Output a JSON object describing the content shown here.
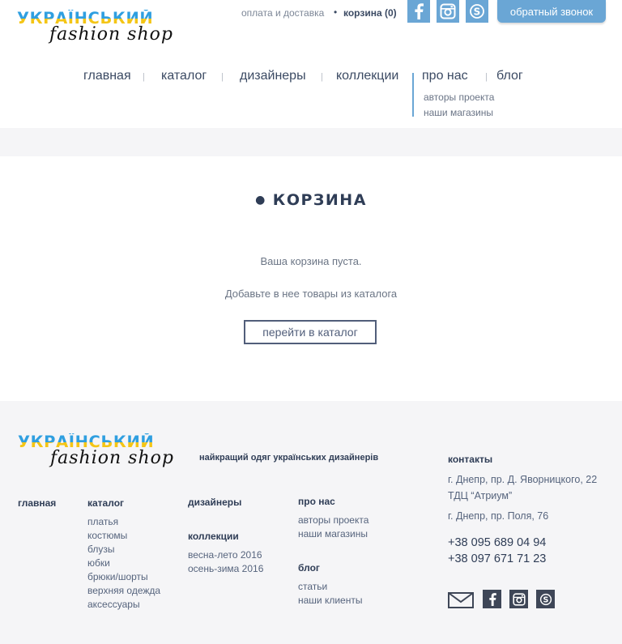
{
  "brand": {
    "line1": "УКРАЇНСЬКИЙ",
    "line2": "fashion shop"
  },
  "header": {
    "delivery": "оплата и доставка",
    "cart": "корзина (0)",
    "callback": "обратный звонок",
    "social": [
      "facebook-icon",
      "instagram-icon",
      "skype-icon"
    ],
    "accent": "#6aa6d5"
  },
  "nav": {
    "items": [
      "главная",
      "каталог",
      "дизайнеры",
      "коллекции",
      "про нас",
      "блог"
    ],
    "separator": "|",
    "about_sub": [
      "авторы проекта",
      "наши магазины"
    ]
  },
  "main": {
    "title": "КОРЗИНА",
    "empty": "Ваша корзина пуста.",
    "add": "Добавьте в нее товары из каталога",
    "button": "перейти в каталог"
  },
  "footer": {
    "slogan": "найкращий одяг українських дизайнерів",
    "home": "главная",
    "catalog": {
      "title": "каталог",
      "items": [
        "платья",
        "костюмы",
        "блузы",
        "юбки",
        "брюки/шорты",
        "верхняя одежда",
        "аксессуары"
      ]
    },
    "designers": "дизайнеры",
    "collections": {
      "title": "коллекции",
      "items": [
        "весна-лето 2016",
        "осень-зима 2016"
      ]
    },
    "about": {
      "title": "про нас",
      "items": [
        "авторы проекта",
        "наши магазины"
      ]
    },
    "blog": {
      "title": "блог",
      "items": [
        "статьи",
        "наши клиенты"
      ]
    },
    "contacts": {
      "title": "контакты",
      "address": "г. Днепр, пр. Д. Яворницкого, 22 ТДЦ “Атриум”",
      "address2": "г. Днепр, пр. Поля, 76",
      "phones": [
        "+38 095 689 04 94",
        "+38 097 671 71 23"
      ]
    },
    "social": [
      "mail-icon",
      "facebook-icon",
      "instagram-icon",
      "skype-icon"
    ]
  }
}
